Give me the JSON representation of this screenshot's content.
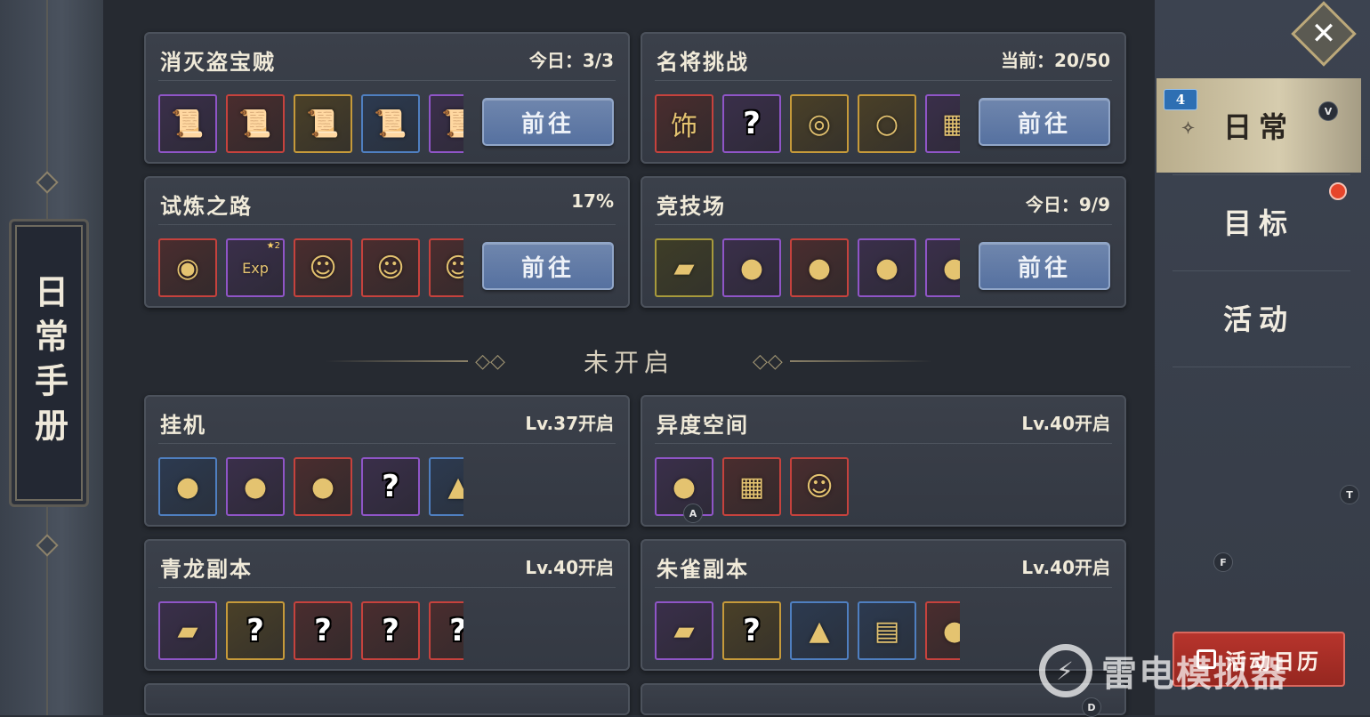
{
  "sidebar_title": "日常手册",
  "divider_label": "未开启",
  "go_label": "前往",
  "active_cards": [
    {
      "title": "消灭盗宝贼",
      "status": "今日：3/3",
      "items": [
        {
          "border": "purple",
          "icon": "scroll-icon",
          "glyph": "📜"
        },
        {
          "border": "red",
          "icon": "scroll-icon",
          "glyph": "📜"
        },
        {
          "border": "gold",
          "icon": "scroll-icon",
          "glyph": "📜"
        },
        {
          "border": "blue",
          "icon": "scroll-icon",
          "glyph": "📜"
        },
        {
          "border": "purple",
          "icon": "scroll-icon",
          "glyph": "📜"
        }
      ]
    },
    {
      "title": "名将挑战",
      "status": "当前：20/50",
      "items": [
        {
          "border": "red",
          "icon": "ornament-badge-icon",
          "glyph": "饰"
        },
        {
          "border": "purple",
          "icon": "unknown-item-icon",
          "glyph": "?"
        },
        {
          "border": "gold",
          "icon": "jade-pendant-icon",
          "glyph": "◎"
        },
        {
          "border": "gold",
          "icon": "ring-icon",
          "glyph": "○"
        },
        {
          "border": "purple",
          "icon": "chest-icon",
          "glyph": "▦"
        }
      ]
    },
    {
      "title": "试炼之路",
      "status": "17%",
      "items": [
        {
          "border": "red",
          "icon": "gold-coin-icon",
          "glyph": "◉"
        },
        {
          "border": "purple",
          "icon": "exp-icon",
          "glyph": "Exp",
          "badge": "★2"
        },
        {
          "border": "red",
          "icon": "hero-portrait-icon",
          "glyph": "☺"
        },
        {
          "border": "red",
          "icon": "hero-portrait-icon",
          "glyph": "☺"
        },
        {
          "border": "red",
          "icon": "hero-portrait-icon",
          "glyph": "☺"
        }
      ]
    },
    {
      "title": "竞技场",
      "status": "今日：9/9",
      "items": [
        {
          "border": "olive",
          "icon": "token-icon",
          "glyph": "▰"
        },
        {
          "border": "purple",
          "icon": "orb-icon",
          "glyph": "●"
        },
        {
          "border": "red",
          "icon": "orb-box-icon",
          "glyph": "●"
        },
        {
          "border": "purple",
          "icon": "fruit-icon",
          "glyph": "●"
        },
        {
          "border": "purple",
          "icon": "orb-icon",
          "glyph": "●"
        }
      ]
    }
  ],
  "locked_cards": [
    {
      "title": "挂机",
      "status": "Lv.37开启",
      "items": [
        {
          "border": "blue",
          "icon": "orb-icon",
          "glyph": "●"
        },
        {
          "border": "purple",
          "icon": "orb-icon",
          "glyph": "●"
        },
        {
          "border": "red",
          "icon": "orb-icon",
          "glyph": "●"
        },
        {
          "border": "purple",
          "icon": "random-portrait-icon",
          "glyph": "?"
        },
        {
          "border": "blue",
          "icon": "gold-ingot-icon",
          "glyph": "▲"
        }
      ]
    },
    {
      "title": "异度空间",
      "status": "Lv.40开启",
      "items": [
        {
          "border": "purple",
          "icon": "orb-box-icon",
          "glyph": "●"
        },
        {
          "border": "red",
          "icon": "treasure-chest-icon",
          "glyph": "▦"
        },
        {
          "border": "red",
          "icon": "hero-portrait-icon",
          "glyph": "☺"
        }
      ]
    },
    {
      "title": "青龙副本",
      "status": "Lv.40开启",
      "items": [
        {
          "border": "purple",
          "icon": "gold-token-icon",
          "glyph": "▰"
        },
        {
          "border": "gold",
          "icon": "unknown-item-icon",
          "glyph": "?"
        },
        {
          "border": "red",
          "icon": "unknown-item-icon",
          "glyph": "?"
        },
        {
          "border": "red",
          "icon": "unknown-item-icon",
          "glyph": "?"
        },
        {
          "border": "red",
          "icon": "unknown-item-icon",
          "glyph": "?"
        }
      ]
    },
    {
      "title": "朱雀副本",
      "status": "Lv.40开启",
      "items": [
        {
          "border": "purple",
          "icon": "gold-token-icon",
          "glyph": "▰"
        },
        {
          "border": "gold",
          "icon": "unknown-item-icon",
          "glyph": "?"
        },
        {
          "border": "blue",
          "icon": "gold-ingot-icon",
          "glyph": "▲"
        },
        {
          "border": "blue",
          "icon": "cloth-icon",
          "glyph": "▤"
        },
        {
          "border": "red",
          "icon": "food-icon",
          "glyph": "●"
        }
      ]
    }
  ],
  "tabs": [
    {
      "label": "日常",
      "count": "4",
      "active": true
    },
    {
      "label": "目标"
    },
    {
      "label": "活动"
    }
  ],
  "calendar_label": "活动日历",
  "watermark_text": "雷电模拟器",
  "key_hints": [
    "V",
    "A",
    "T",
    "F",
    "D"
  ]
}
